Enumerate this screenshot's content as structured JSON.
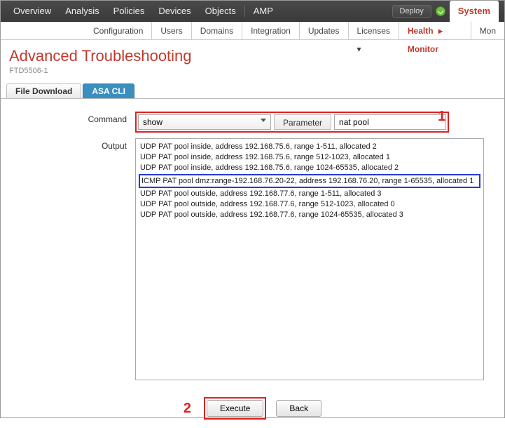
{
  "topnav": {
    "items": [
      "Overview",
      "Analysis",
      "Policies",
      "Devices",
      "Objects",
      "AMP"
    ],
    "deploy": "Deploy",
    "system": "System"
  },
  "subnav": {
    "items": [
      "Configuration",
      "Users",
      "Domains",
      "Integration",
      "Updates",
      "Licenses ▾"
    ],
    "health_label": "Health",
    "health_arrow": "▸",
    "monitor_label": "Monitor",
    "mon_partial": "Mon"
  },
  "page": {
    "title": "Advanced Troubleshooting",
    "device": "FTD5506-1"
  },
  "tabs": {
    "file_download": "File Download",
    "asa_cli": "ASA CLI"
  },
  "form": {
    "command_label": "Command",
    "command_value": "show",
    "parameter_label": "Parameter",
    "parameter_value": "nat pool",
    "output_label": "Output"
  },
  "callouts": {
    "one": "1",
    "two": "2"
  },
  "output_lines": [
    "UDP PAT pool inside, address 192.168.75.6, range 1-511, allocated 2",
    "UDP PAT pool inside, address 192.168.75.6, range 512-1023, allocated 1",
    "UDP PAT pool inside, address 192.168.75.6, range 1024-65535, allocated 2",
    "ICMP PAT pool dmz:range-192.168.76.20-22, address 192.168.76.20, range 1-65535, allocated 1",
    "UDP PAT pool outside, address 192.168.77.6, range 1-511, allocated 3",
    "UDP PAT pool outside, address 192.168.77.6, range 512-1023, allocated 0",
    "UDP PAT pool outside, address 192.168.77.6, range 1024-65535, allocated 3"
  ],
  "highlight_index": 3,
  "buttons": {
    "execute": "Execute",
    "back": "Back"
  }
}
